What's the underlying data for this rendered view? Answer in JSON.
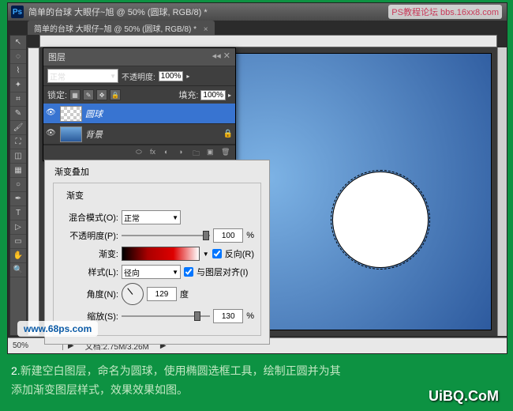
{
  "titlebar": {
    "ps": "Ps",
    "doc_title": "简单的台球  大眼仔~旭 @ 50% (圆球, RGB/8) *"
  },
  "tab": {
    "label": "简单的台球  大眼仔~旭 @ 50% (圆球, RGB/8) *",
    "close": "×"
  },
  "status": {
    "zoom": "50%",
    "doc": "文档:2.75M/3.26M",
    "arrow": "▶"
  },
  "layers": {
    "title": "图层",
    "blend": "正常",
    "opacity_label": "不透明度:",
    "opacity": "100%",
    "lock_label": "锁定:",
    "fill_label": "填充:",
    "fill": "100%",
    "items": [
      {
        "name": "圆球",
        "locked": false
      },
      {
        "name": "背景",
        "locked": true
      }
    ]
  },
  "style": {
    "title": "渐变叠加",
    "group": "渐变",
    "blend_lbl": "混合模式(O):",
    "blend_val": "正常",
    "opacity_lbl": "不透明度(P):",
    "opacity_val": "100",
    "pct": "%",
    "grad_lbl": "渐变:",
    "reverse": "反向(R)",
    "style_lbl": "样式(L):",
    "style_val": "径向",
    "align": "与图层对齐(I)",
    "angle_lbl": "角度(N):",
    "angle_val": "129",
    "deg": "度",
    "scale_lbl": "缩放(S):",
    "scale_val": "130"
  },
  "watermark1": "www.68ps.com",
  "watermark2": "PS教程论坛\nbbs.16xx8.com",
  "watermark3": "UiBQ.CoM",
  "caption_num": "2.",
  "caption_text1": "新建空白图层，命名为圆球，使用椭圆选框工具，绘制正圆并为其",
  "caption_text2": "添加渐变图层样式，效果效果如图。"
}
